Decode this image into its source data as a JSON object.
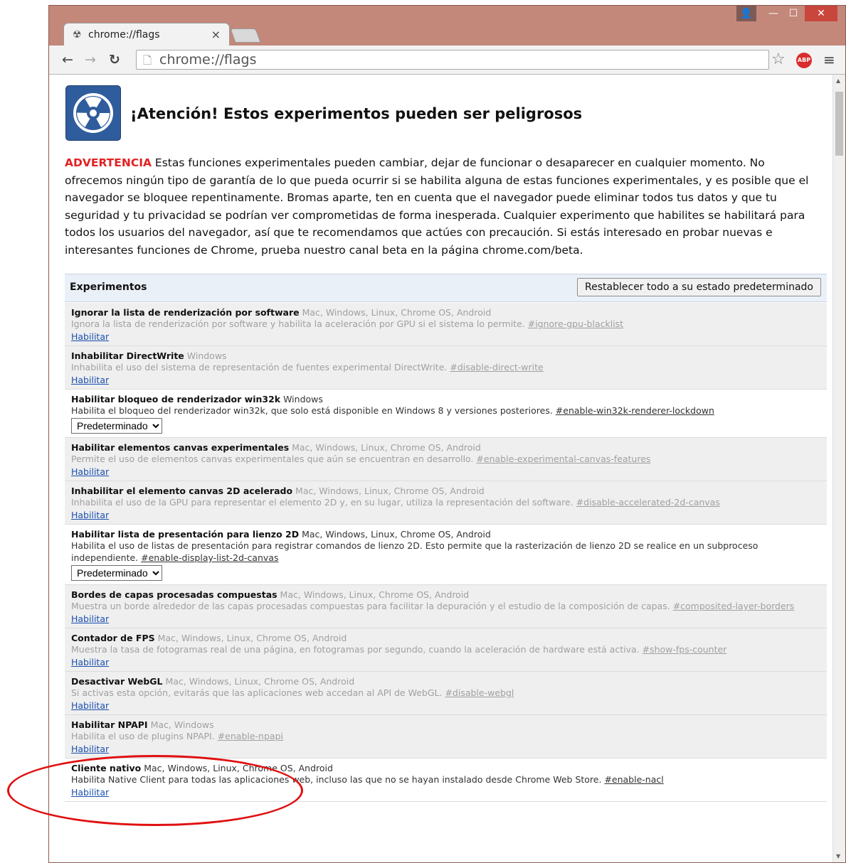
{
  "browser": {
    "tab_title": "chrome://flags",
    "tab_close": "×",
    "address": "chrome://flags",
    "abp_label": "ABP",
    "icons": [
      "back-icon",
      "forward-icon",
      "reload-icon",
      "page-icon",
      "star-icon",
      "abp-icon",
      "menu-icon",
      "user-icon",
      "minimize-icon",
      "maximize-icon",
      "close-icon"
    ]
  },
  "page": {
    "heading": "¡Atención! Estos experimentos pueden ser peligrosos",
    "warning_label": "ADVERTENCIA",
    "warning_text": " Estas funciones experimentales pueden cambiar, dejar de funcionar o desaparecer en cualquier momento. No ofrecemos ningún tipo de garantía de lo que pueda ocurrir si se habilita alguna de estas funciones experimentales, y es posible que el navegador se bloquee repentinamente. Bromas aparte, ten en cuenta que el navegador puede eliminar todos tus datos y que tu seguridad y tu privacidad se podrían ver comprometidas de forma inesperada. Cualquier experimento que habilites se habilitará para todos los usuarios del navegador, así que te recomendamos que actúes con precaución. Si estás interesado en probar nuevas e interesantes funciones de Chrome, prueba nuestro canal beta en la página chrome.com/beta.",
    "experiments_title": "Experimentos",
    "reset_button": "Restablecer todo a su estado predeterminado"
  },
  "experiments": [
    {
      "name": "Ignorar la lista de renderización por software",
      "platforms": " Mac, Windows, Linux, Chrome OS, Android",
      "desc": "Ignora la lista de renderización por software y habilita la aceleración por GPU si el sistema lo permite. ",
      "anchor": "#ignore-gpu-blacklist",
      "action": "Habilitar",
      "state": "disabled"
    },
    {
      "name": "Inhabilitar DirectWrite",
      "platforms": " Windows",
      "desc": "Inhabilita el uso del sistema de representación de fuentes experimental DirectWrite. ",
      "anchor": "#disable-direct-write",
      "action": "Habilitar",
      "state": "disabled"
    },
    {
      "name": "Habilitar bloqueo de renderizador win32k",
      "platforms": " Windows",
      "desc": "Habilita el bloqueo del renderizador win32k, que solo está disponible en Windows 8 y versiones posteriores. ",
      "anchor": "#enable-win32k-renderer-lockdown",
      "select": "Predeterminado",
      "state": "enabled"
    },
    {
      "name": "Habilitar elementos canvas experimentales",
      "platforms": " Mac, Windows, Linux, Chrome OS, Android",
      "desc": "Permite el uso de elementos canvas experimentales que aún se encuentran en desarrollo. ",
      "anchor": "#enable-experimental-canvas-features",
      "action": "Habilitar",
      "state": "disabled"
    },
    {
      "name": "Inhabilitar el elemento canvas 2D acelerado",
      "platforms": " Mac, Windows, Linux, Chrome OS, Android",
      "desc": "Inhabilita el uso de la GPU para representar el elemento 2D y, en su lugar, utiliza la representación del software. ",
      "anchor": "#disable-accelerated-2d-canvas",
      "action": "Habilitar",
      "state": "disabled"
    },
    {
      "name": "Habilitar lista de presentación para lienzo 2D",
      "platforms": " Mac, Windows, Linux, Chrome OS, Android",
      "desc": "Habilita el uso de listas de presentación para registrar comandos de lienzo 2D. Esto permite que la rasterización de lienzo 2D se realice en un subproceso independiente. ",
      "anchor": "#enable-display-list-2d-canvas",
      "select": "Predeterminado",
      "state": "enabled"
    },
    {
      "name": "Bordes de capas procesadas compuestas",
      "platforms": " Mac, Windows, Linux, Chrome OS, Android",
      "desc": "Muestra un borde alrededor de las capas procesadas compuestas para facilitar la depuración y el estudio de la composición de capas. ",
      "anchor": "#composited-layer-borders",
      "action": "Habilitar",
      "state": "disabled"
    },
    {
      "name": "Contador de FPS",
      "platforms": " Mac, Windows, Linux, Chrome OS, Android",
      "desc": "Muestra la tasa de fotogramas real de una página, en fotogramas por segundo, cuando la aceleración de hardware está activa. ",
      "anchor": "#show-fps-counter",
      "action": "Habilitar",
      "state": "disabled"
    },
    {
      "name": "Desactivar WebGL",
      "platforms": " Mac, Windows, Linux, Chrome OS, Android",
      "desc": "Si activas esta opción, evitarás que las aplicaciones web accedan al API de WebGL. ",
      "anchor": "#disable-webgl",
      "action": "Habilitar",
      "state": "disabled"
    },
    {
      "name": "Habilitar NPAPI",
      "platforms": " Mac, Windows",
      "desc": "Habilita el uso de plugins NPAPI. ",
      "anchor": "#enable-npapi",
      "action": "Habilitar",
      "state": "disabled"
    },
    {
      "name": "Cliente nativo",
      "platforms": " Mac, Windows, Linux, Chrome OS, Android",
      "desc": "Habilita Native Client para todas las aplicaciones web, incluso las que no se hayan instalado desde Chrome Web Store. ",
      "anchor": "#enable-nacl",
      "action": "Habilitar",
      "state": "enabled"
    }
  ]
}
